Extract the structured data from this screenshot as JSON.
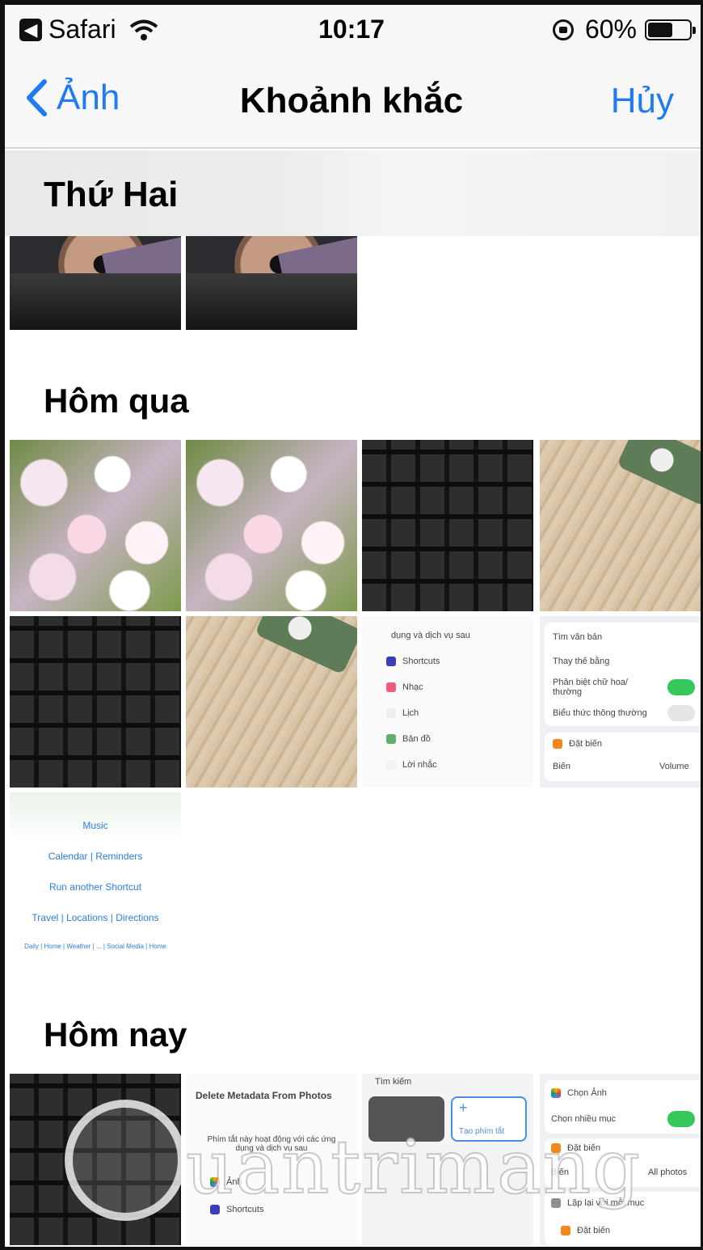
{
  "status_bar": {
    "back_app": "Safari",
    "time": "10:17",
    "battery": "60%",
    "battery_level": 0.6
  },
  "nav": {
    "back_label": "Ảnh",
    "title": "Khoảnh khắc",
    "cancel_label": "Hủy"
  },
  "sections": [
    {
      "title": "Thứ Hai"
    },
    {
      "title": "Hôm qua"
    },
    {
      "title": "Hôm nay"
    }
  ],
  "screenshot_texts": {
    "menu1": [
      "Shortcuts",
      "Nhạc",
      "Lịch",
      "Bản đồ",
      "Lời nhắc"
    ],
    "menu1_header": "dụng và dịch vụ sau",
    "settings1": [
      "Tìm văn bản",
      "Thay thế bằng",
      "Phân biệt chữ hoa/ thường",
      "Biểu thức thông thường",
      "Đặt biến",
      "Biến",
      "Volume"
    ],
    "links": [
      "Music",
      "Calendar | Reminders",
      "Run another Shortcut",
      "Travel | Locations | Directions",
      "Daily | Home | Weather | ... | Social Media | Home"
    ],
    "delete_title": "Delete Metadata From Photos",
    "delete_desc": "Phím tắt này hoạt động với các ứng dụng và dịch vụ sau",
    "delete_items": [
      "Ảnh",
      "Shortcuts"
    ],
    "search_label": "Tìm kiếm",
    "new_shortcut": "Tạo phím tắt",
    "photos_settings": [
      "Chọn Ảnh",
      "Chọn nhiều mục",
      "Đặt biến",
      "Biến",
      "All photos",
      "Lặp lại với mỗi mục",
      "Đặt biến"
    ]
  },
  "watermark": "uantrimang"
}
